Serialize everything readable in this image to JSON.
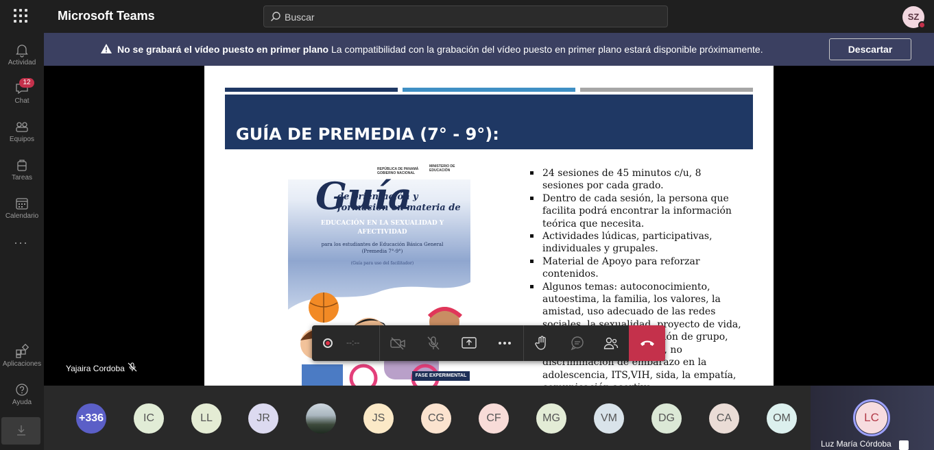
{
  "app": {
    "title": "Microsoft Teams"
  },
  "search": {
    "placeholder": "Buscar"
  },
  "user": {
    "initials": "SZ"
  },
  "rail": {
    "items": [
      {
        "label": "Actividad",
        "icon": "bell-icon"
      },
      {
        "label": "Chat",
        "icon": "chat-icon",
        "badge": "12"
      },
      {
        "label": "Equipos",
        "icon": "teams-icon"
      },
      {
        "label": "Tareas",
        "icon": "tasks-icon"
      },
      {
        "label": "Calendario",
        "icon": "calendar-icon"
      }
    ],
    "more": "···",
    "bottom": [
      {
        "label": "Aplicaciones",
        "icon": "apps-icon"
      },
      {
        "label": "Ayuda",
        "icon": "help-icon"
      }
    ]
  },
  "banner": {
    "bold": "No se grabará el vídeo puesto en primer plano",
    "text": "La compatibilidad con la grabación del vídeo puesto en primer plano estará disponible próximamente.",
    "dismiss": "Descartar"
  },
  "slide": {
    "title": "GUÍA DE PREMEDIA (7° - 9°):",
    "cover": {
      "gov_left": "REPÚBLICA DE PANAMÁ",
      "gov_left_sub": "GOBIERNO NACIONAL",
      "gov_right": "MINISTERIO DE EDUCACIÓN",
      "guia": "Guía",
      "subtitle": "de orientación y formación en materia de",
      "edu": "EDUCACIÓN EN LA SEXUALIDAD Y AFECTIVIDAD",
      "for": "para los estudiantes de Educación Básica General (Premedia 7°-9°)",
      "guide": "(Guía para uso del facilitador)",
      "tag": "FASE EXPERIMENTAL"
    },
    "bullets": [
      "24 sesiones de 45 minutos c/u, 8 sesiones por cada grado.",
      "Dentro de cada sesión, la persona que facilita podrá encontrar la información teórica que necesita.",
      "Actividades lúdicas, participativas, individuales y grupales.",
      "Material de Apoyo para reforzar contenidos.",
      "Algunos temas: autoconocimiento, autoestima, la familia, los valores, la amistad, uso adecuado de las redes sociales, la sexualidad, proyecto de vida, toma de decisiones, presión de grupo, manejo de las emociones, no discriminación de embarazo en la adolescencia, ITS,VIH, sida, la empatía, comunicación asertiva."
    ]
  },
  "presenter": {
    "name": "Yajaira Cordoba"
  },
  "controls": {
    "timer": "--:--"
  },
  "participants": [
    "+336",
    "IC",
    "LL",
    "JR",
    "",
    "JS",
    "CG",
    "CF",
    "MG",
    "VM",
    "DG",
    "CA",
    "OM"
  ],
  "participant_colors": [
    "#5b5fc7",
    "#e1ecd6",
    "#e4ecd4",
    "#dcdaf0",
    "#888888",
    "#fbe9c7",
    "#fbe3cf",
    "#f8dcd8",
    "#e3ecd6",
    "#d9e3ea",
    "#dbe8d6",
    "#eadcd6",
    "#dcf0ee"
  ],
  "self": {
    "initials": "LC",
    "name": "Luz María Córdoba"
  }
}
